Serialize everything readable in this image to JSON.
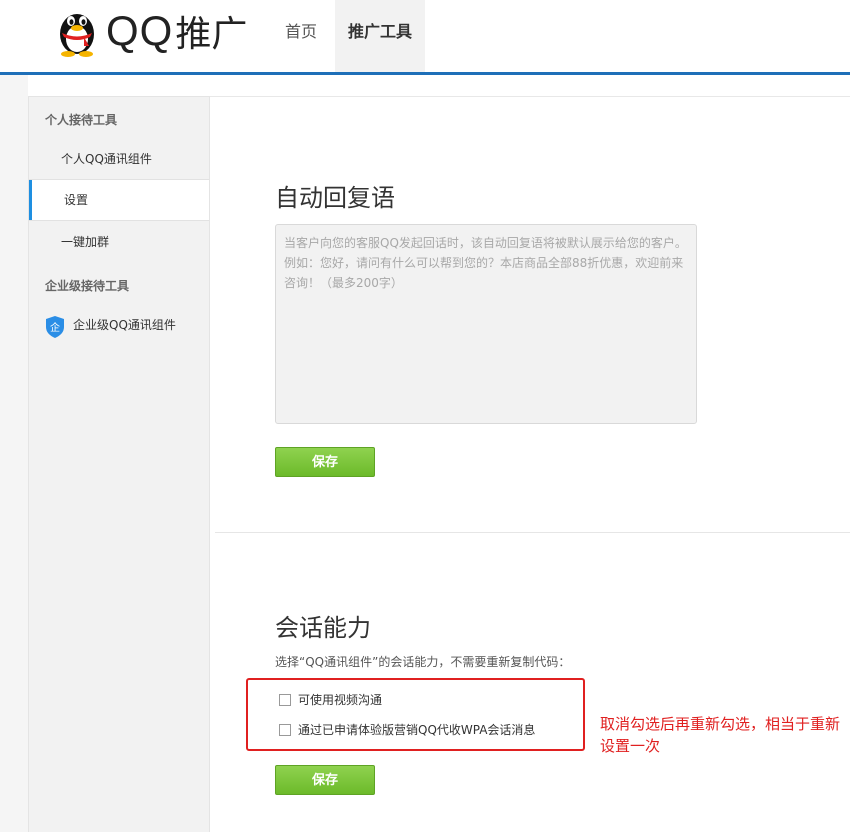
{
  "header": {
    "brand_qq": "QQ",
    "brand_cn": "推广",
    "nav": [
      "首页",
      "推广工具"
    ],
    "active_nav": "推广工具"
  },
  "sidebar": {
    "group1": "个人接待工具",
    "items1": [
      "个人QQ通讯组件",
      "设置",
      "一键加群"
    ],
    "active_item": "设置",
    "group2": "企业级接待工具",
    "items2": [
      "企业级QQ通讯组件"
    ],
    "shield_char": "企"
  },
  "auto_reply": {
    "title": "自动回复语",
    "placeholder": "当客户向您的客服QQ发起回话时，该自动回复语将被默认展示给您的客户。例如：您好，请问有什么可以帮到您的？本店商品全部88折优惠，欢迎前来咨询！（最多200字）",
    "save_label": "保存"
  },
  "session": {
    "title": "会话能力",
    "description": "选择“QQ通讯组件”的会话能力，不需要重新复制代码：",
    "options": [
      "可使用视频沟通",
      "通过已申请体验版营销QQ代收WPA会话消息"
    ],
    "save_label": "保存"
  },
  "annotation": "取消勾选后再重新勾选，相当于重新设置一次",
  "colors": {
    "header_line": "#1e6fb8",
    "active_marker": "#1e8fe1",
    "save_green": "#6cba2a",
    "annotation_red": "#e02020"
  }
}
